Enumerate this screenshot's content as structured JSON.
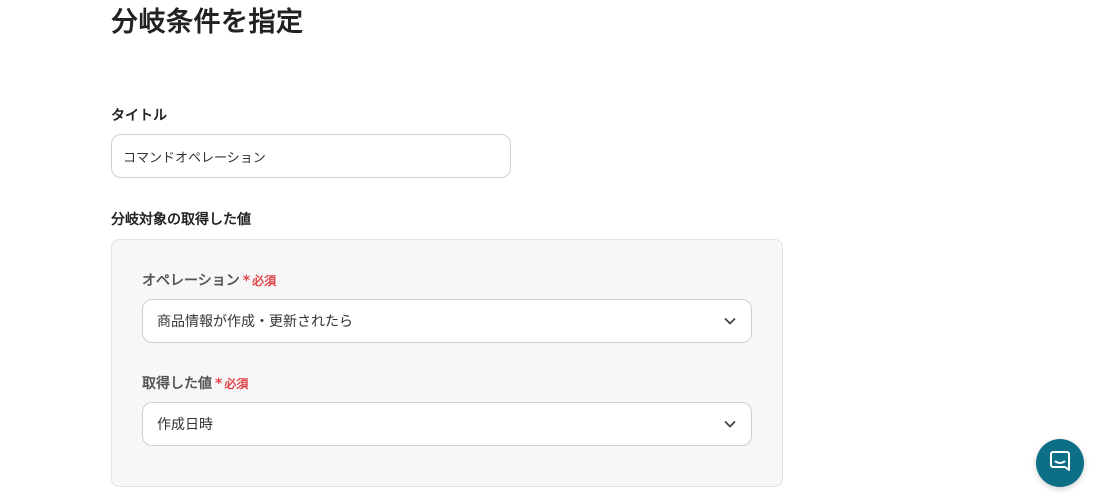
{
  "page": {
    "title": "分岐条件を指定"
  },
  "title_field": {
    "label": "タイトル",
    "value": "コマンドオペレーション"
  },
  "branch_section": {
    "label": "分岐対象の取得した値",
    "operation": {
      "label": "オペレーション",
      "required_mark": "*",
      "required_text": "必須",
      "selected": "商品情報が作成・更新されたら"
    },
    "acquired_value": {
      "label": "取得した値",
      "required_mark": "*",
      "required_text": "必須",
      "selected": "作成日時"
    }
  },
  "icons": {
    "dropdown": "chevron-down-icon",
    "chat": "chat-icon"
  },
  "colors": {
    "required": "#e0474c",
    "chat_button": "#0d6f86",
    "panel_bg": "#f7f7f7"
  }
}
